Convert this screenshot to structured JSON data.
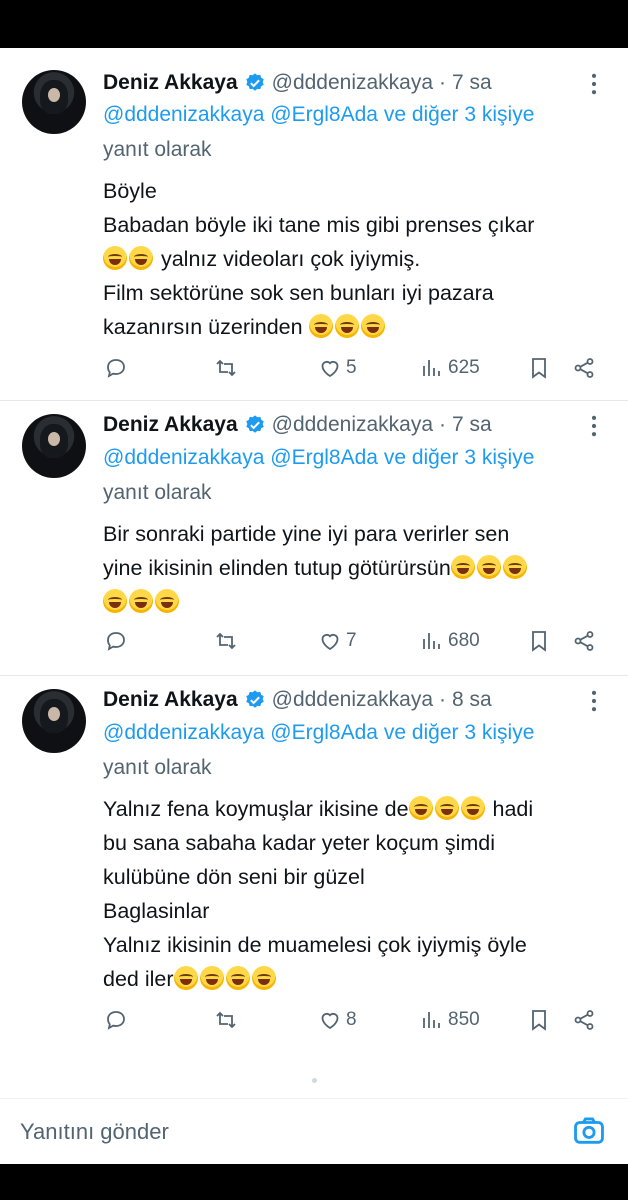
{
  "tweets": [
    {
      "author": {
        "name": "Deniz Akkaya",
        "handle": "@dddenizakkaya",
        "time": "7 sa"
      },
      "reply_to": {
        "mentions": "@dddenizakkaya @Ergl8Ada",
        "others": "ve diğer 3 kişiye",
        "suffix": "yanıt olarak"
      },
      "lines": [
        {
          "text": "Böyle",
          "emoji_before": 0,
          "emoji_after": 0
        },
        {
          "text": "Babadan böyle iki tane mis gibi prenses çıkar",
          "emoji_before": 0,
          "emoji_after": 0
        },
        {
          "text": " yalnız videoları çok iyiymiş.",
          "emoji_before": 2,
          "emoji_after": 0
        },
        {
          "text": "Film sektörüne sok sen bunları iyi pazara",
          "emoji_before": 0,
          "emoji_after": 0
        },
        {
          "text": "kazanırsın üzerinden",
          "emoji_before": 0,
          "emoji_after": 3
        }
      ],
      "stats": {
        "replies": "",
        "retweets": "",
        "likes": "5",
        "views": "625"
      }
    },
    {
      "author": {
        "name": "Deniz Akkaya",
        "handle": "@dddenizakkaya",
        "time": "7 sa"
      },
      "reply_to": {
        "mentions": "@dddenizakkaya @Ergl8Ada",
        "others": "ve diğer 3 kişiye",
        "suffix": "yanıt olarak"
      },
      "lines": [
        {
          "text": "Bir sonraki partide yine iyi para verirler sen",
          "emoji_before": 0,
          "emoji_after": 0
        },
        {
          "text": "yine ikisinin elinden tutup götürürsün",
          "emoji_before": 0,
          "emoji_after": 3
        },
        {
          "text": "",
          "emoji_before": 3,
          "emoji_after": 0
        }
      ],
      "stats": {
        "replies": "",
        "retweets": "",
        "likes": "7",
        "views": "680"
      }
    },
    {
      "author": {
        "name": "Deniz Akkaya",
        "handle": "@dddenizakkaya",
        "time": "8 sa"
      },
      "reply_to": {
        "mentions": "@dddenizakkaya @Ergl8Ada",
        "others": "ve diğer 3 kişiye",
        "suffix": "yanıt olarak"
      },
      "lines": [
        {
          "text": "Yalnız fena koymuşlar ikisine de",
          "emoji_before": 0,
          "emoji_after": 3,
          "tail": " hadi"
        },
        {
          "text": "bu sana sabaha kadar yeter koçum şimdi",
          "emoji_before": 0,
          "emoji_after": 0
        },
        {
          "text": "kulübüne dön seni bir güzel",
          "emoji_before": 0,
          "emoji_after": 0
        },
        {
          "text": "Baglasinlar",
          "emoji_before": 0,
          "emoji_after": 0
        },
        {
          "text": "Yalnız ikisinin de muamelesi çok iyiymiş öyle",
          "emoji_before": 0,
          "emoji_after": 0
        },
        {
          "text": "ded iler",
          "emoji_before": 0,
          "emoji_after": 4
        }
      ],
      "stats": {
        "replies": "",
        "retweets": "",
        "likes": "8",
        "views": "850"
      }
    }
  ],
  "reply_bar": {
    "placeholder": "Yanıtını gönder"
  },
  "icons": {
    "verified": "verified-badge-icon",
    "more": "more-dots-icon",
    "reply": "reply-bubble-icon",
    "retweet": "retweet-icon",
    "like": "heart-icon",
    "views": "views-bar-chart-icon",
    "bookmark": "bookmark-icon",
    "share": "share-icon",
    "camera": "camera-icon"
  },
  "colors": {
    "link": "#1d9bf0",
    "muted": "#536471",
    "text": "#0f1419"
  }
}
